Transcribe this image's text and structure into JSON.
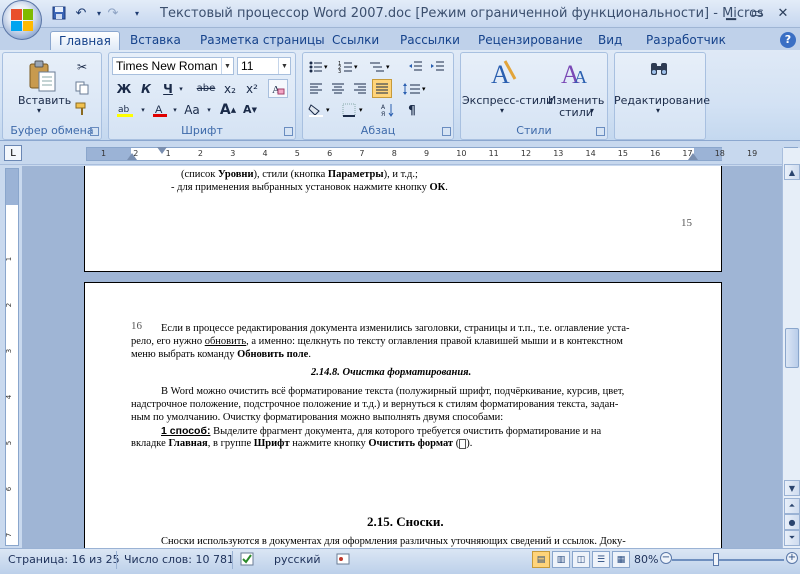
{
  "window": {
    "title": "Текстовый процессор Word 2007.doc [Режим ограниченной функциональности] - Micros",
    "controls": [
      "minimize",
      "maximize",
      "close"
    ]
  },
  "quick_access": [
    "save-icon",
    "undo-icon",
    "redo-icon",
    "customize-icon"
  ],
  "tabs": [
    "Главная",
    "Вставка",
    "Разметка страницы",
    "Ссылки",
    "Рассылки",
    "Рецензирование",
    "Вид",
    "Разработчик"
  ],
  "ribbon": {
    "clipboard": {
      "label": "Буфер обмена",
      "paste": "Вставить"
    },
    "font": {
      "label": "Шрифт",
      "font_name": "Times New Roman",
      "font_size": "11",
      "bold": "Ж",
      "italic": "К",
      "underline": "Ч",
      "strike": "abe",
      "subscript": "x₂",
      "superscript": "x²",
      "grow": "A",
      "shrink": "A",
      "case": "Aa"
    },
    "paragraph": {
      "label": "Абзац"
    },
    "styles": {
      "label": "Стили",
      "express": "Экспресс-стили",
      "change_line1": "Изменить",
      "change_line2": "стили"
    },
    "editing": {
      "label": "Редактирование"
    }
  },
  "ruler": {
    "numbers": [
      "1",
      "2",
      "1",
      "2",
      "3",
      "4",
      "5",
      "6",
      "7",
      "8",
      "9",
      "10",
      "11",
      "12",
      "13",
      "14",
      "15",
      "16",
      "17",
      "18",
      "19"
    ]
  },
  "document": {
    "page15": {
      "line1_a": "(список ",
      "line1_b": "Уровни",
      "line1_c": "), стили (кнопка ",
      "line1_d": "Параметры",
      "line1_e": "), и т.д.;",
      "line2_a": "-  для применения выбранных установок нажмите кнопку ",
      "line2_b": "ОК",
      "line2_c": ".",
      "page_number": "15"
    },
    "page16": {
      "page_number": "16",
      "p1_l1": "Если в процессе редактирования документа изменились заголовки, страницы и т.п., т.е. оглавление уста-",
      "p1_l2_a": "рело, его нужно ",
      "p1_l2_b": "обновить",
      "p1_l2_c": ", а именно: щелкнуть по тексту оглавления правой клавишей мыши и в контекстном",
      "p1_l3_a": "меню выбрать команду ",
      "p1_l3_b": "Обновить поле",
      "p1_l3_c": ".",
      "heading": "2.14.8. Очистка форматирования.",
      "p2_l1": "В Word можно очистить всё форматирование текста (полужирный шрифт, подчёркивание, курсив, цвет,",
      "p2_l2": "надстрочное положение, подстрочное положение и т.д.) и вернуться к стилям форматирования текста, задан-",
      "p2_l3": "ным по умолчанию. Очистку форматирования можно выполнять двумя способами:",
      "p3_l1_a": "1 способ:",
      "p3_l1_b": " Выделите фрагмент документа, для которого требуется очистить форматирование и на",
      "p3_l2_a": "вкладке ",
      "p3_l2_b": "Главная",
      "p3_l2_c": ", в группе ",
      "p3_l2_d": "Шрифт",
      "p3_l2_e": " нажмите кнопку ",
      "p3_l2_f": "Очистить формат",
      "p3_l2_g": " (",
      "p3_l2_h": ").",
      "section": "2.15. Сноски.",
      "p4_l1": "Сноски используются в документах для оформления различных уточняющих сведений и ссылок. Доку-"
    }
  },
  "status": {
    "page": "Страница: 16 из 25",
    "words": "Число слов: 10 781",
    "language": "русский",
    "zoom": "80%",
    "zoom_value_percent": 80
  },
  "colors": {
    "ribbon_bg": "#d3e2f4",
    "tab_text": "#15428b",
    "group_label": "#3e6aaa",
    "doc_bg": "#9fb5d5",
    "highlight_yellow": "#ffff00",
    "font_color_red": "#e00000"
  }
}
